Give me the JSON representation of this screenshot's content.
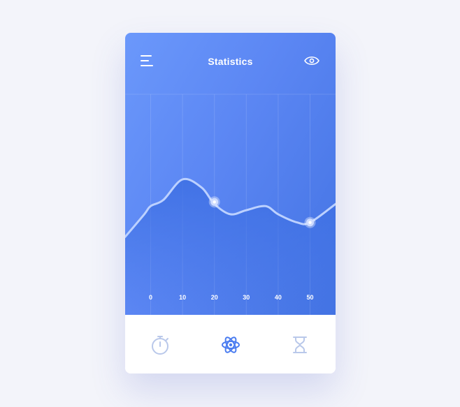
{
  "header": {
    "title": "Statistics",
    "menu_icon": "menu-icon",
    "eye_icon": "eye-icon"
  },
  "chart_data": {
    "type": "area",
    "title": "",
    "xlabel": "",
    "ylabel": "",
    "x_ticks": [
      0,
      10,
      20,
      30,
      40,
      50
    ],
    "xlim": [
      -8,
      58
    ],
    "ylim": [
      0,
      100
    ],
    "grid": true,
    "series": [
      {
        "x": [
          -8,
          -2,
          0,
          4,
          10,
          16,
          20,
          25,
          30,
          36,
          40,
          46,
          50,
          58
        ],
        "values": [
          38,
          49,
          53,
          56,
          66,
          62,
          54,
          49,
          51,
          53,
          49,
          45,
          45,
          54
        ],
        "highlighted_points": [
          {
            "x": 20,
            "y": 55
          },
          {
            "x": 50,
            "y": 45
          }
        ]
      }
    ],
    "colors": {
      "line": "#bcd1ff",
      "fill_top": "#3d6fe3",
      "background": "#5b86f3"
    }
  },
  "tabs": [
    {
      "icon": "stopwatch-icon",
      "active": false
    },
    {
      "icon": "atom-icon",
      "active": true
    },
    {
      "icon": "hourglass-icon",
      "active": false
    }
  ],
  "colors": {
    "accent": "#4a7cf0",
    "inactive_icon": "#b9c8ea",
    "page_background": "#f3f4fa"
  }
}
